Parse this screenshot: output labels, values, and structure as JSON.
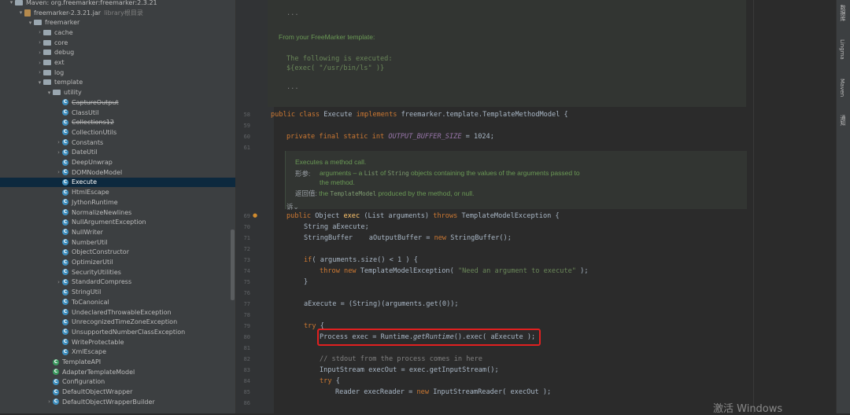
{
  "tree": {
    "items": [
      {
        "label": "Maven: org.freemarker:freemarker:2.3.21",
        "indent": 0,
        "arrow": "▾",
        "icon": "folder"
      },
      {
        "label": "freemarker-2.3.21.jar",
        "extra": "library根目录",
        "indent": 1,
        "arrow": "▾",
        "icon": "jar"
      },
      {
        "label": "freemarker",
        "indent": 2,
        "arrow": "▾",
        "icon": "folder"
      },
      {
        "label": "cache",
        "indent": 3,
        "arrow": "›",
        "icon": "folder"
      },
      {
        "label": "core",
        "indent": 3,
        "arrow": "›",
        "icon": "folder"
      },
      {
        "label": "debug",
        "indent": 3,
        "arrow": "›",
        "icon": "folder"
      },
      {
        "label": "ext",
        "indent": 3,
        "arrow": "›",
        "icon": "folder"
      },
      {
        "label": "log",
        "indent": 3,
        "arrow": "›",
        "icon": "folder"
      },
      {
        "label": "template",
        "indent": 3,
        "arrow": "▾",
        "icon": "folder"
      },
      {
        "label": "utility",
        "indent": 4,
        "arrow": "▾",
        "icon": "folder"
      },
      {
        "label": "CaptureOutput",
        "indent": 5,
        "icon": "class",
        "strike": true
      },
      {
        "label": "ClassUtil",
        "indent": 5,
        "icon": "class"
      },
      {
        "label": "Collections12",
        "indent": 5,
        "icon": "class",
        "strike": true
      },
      {
        "label": "CollectionUtils",
        "indent": 5,
        "icon": "class"
      },
      {
        "label": "Constants",
        "indent": 5,
        "arrow": "›",
        "icon": "class"
      },
      {
        "label": "DateUtil",
        "indent": 5,
        "arrow": "›",
        "icon": "class"
      },
      {
        "label": "DeepUnwrap",
        "indent": 5,
        "icon": "class"
      },
      {
        "label": "DOMNodeModel",
        "indent": 5,
        "arrow": "›",
        "icon": "class"
      },
      {
        "label": "Execute",
        "indent": 5,
        "icon": "class",
        "selected": true
      },
      {
        "label": "HtmlEscape",
        "indent": 5,
        "icon": "class"
      },
      {
        "label": "JythonRuntime",
        "indent": 5,
        "icon": "class"
      },
      {
        "label": "NormalizeNewlines",
        "indent": 5,
        "icon": "class"
      },
      {
        "label": "NullArgumentException",
        "indent": 5,
        "icon": "class"
      },
      {
        "label": "NullWriter",
        "indent": 5,
        "icon": "class"
      },
      {
        "label": "NumberUtil",
        "indent": 5,
        "icon": "class"
      },
      {
        "label": "ObjectConstructor",
        "indent": 5,
        "icon": "class"
      },
      {
        "label": "OptimizerUtil",
        "indent": 5,
        "icon": "class"
      },
      {
        "label": "SecurityUtilities",
        "indent": 5,
        "icon": "class"
      },
      {
        "label": "StandardCompress",
        "indent": 5,
        "arrow": "›",
        "icon": "class"
      },
      {
        "label": "StringUtil",
        "indent": 5,
        "icon": "class"
      },
      {
        "label": "ToCanonical",
        "indent": 5,
        "icon": "class"
      },
      {
        "label": "UndeclaredThrowableException",
        "indent": 5,
        "icon": "class"
      },
      {
        "label": "UnrecognizedTimeZoneException",
        "indent": 5,
        "icon": "class"
      },
      {
        "label": "UnsupportedNumberClassException",
        "indent": 5,
        "icon": "class"
      },
      {
        "label": "WriteProtectable",
        "indent": 5,
        "icon": "class"
      },
      {
        "label": "XmlEscape",
        "indent": 5,
        "icon": "class"
      },
      {
        "label": "TemplateAPI",
        "indent": 4,
        "icon": "class",
        "green": true
      },
      {
        "label": "AdapterTemplateModel",
        "indent": 4,
        "icon": "class",
        "green": true
      },
      {
        "label": "Configuration",
        "indent": 4,
        "icon": "class"
      },
      {
        "label": "DefaultObjectWrapper",
        "indent": 4,
        "icon": "class"
      },
      {
        "label": "DefaultObjectWrapperBuilder",
        "indent": 4,
        "arrow": "›",
        "icon": "class"
      }
    ]
  },
  "doc_top": {
    "ellipsis1": "...",
    "from_text": "From your FreeMarker template:",
    "exec_line1": "The following is executed:",
    "exec_line2": "${exec( \"/usr/bin/ls\" )}",
    "ellipsis2": "..."
  },
  "doc_method": {
    "summary": "Executes a method call.",
    "param_label": "形参:",
    "param_text_a": "arguments – a ",
    "param_code_list": "List",
    "param_text_b": " of ",
    "param_code_string": "String",
    "param_text_c": " objects containing the values of the arguments passed to",
    "param_text_d": "the method.",
    "return_label": "返回值:",
    "return_text_a": "the ",
    "return_code": "TemplateModel",
    "return_text_b": " produced by the method, or null.",
    "collapse": "诉⌄"
  },
  "line_numbers": {
    "l58": "58",
    "l59": "59",
    "l60": "60",
    "l61": "61",
    "l69": "69",
    "l70": "70",
    "l71": "71",
    "l72": "72",
    "l73": "73",
    "l74": "74",
    "l75": "75",
    "l76": "76",
    "l77": "77",
    "l78": "78",
    "l79": "79",
    "l80": "80",
    "l81": "81",
    "l82": "82",
    "l83": "83",
    "l84": "84",
    "l85": "85",
    "l86": "86"
  },
  "code": {
    "c58a": "public class ",
    "c58b": "Execute ",
    "c58c": "implements ",
    "c58d": "freemarker.template.TemplateMethodModel {",
    "c60a": "private final static int ",
    "c60b": "OUTPUT_BUFFER_SIZE",
    "c60c": " = 1024;",
    "c69a": "public ",
    "c69b": "Object ",
    "c69c": "exec",
    "c69d": " (List arguments) ",
    "c69e": "throws ",
    "c69f": "TemplateModelException {",
    "c70": "String aExecute;",
    "c71a": "StringBuffer    aOutputBuffer = ",
    "c71b": "new ",
    "c71c": "StringBuffer();",
    "c73a": "if",
    "c73b": "( arguments.size() < 1 ) {",
    "c74a": "throw new ",
    "c74b": "TemplateModelException( ",
    "c74c": "\"Need an argument to execute\"",
    "c74d": " );",
    "c75": "}",
    "c77": "aExecute = (String)(arguments.get(0));",
    "c79a": "try",
    "c79b": " {",
    "c80a": "Process exec = Runtime.",
    "c80b": "getRuntime",
    "c80c": "().exec( aExecute );",
    "c82": "// stdout from the process comes in here",
    "c83": "InputStream execOut = exec.getInputStream();",
    "c84a": "try",
    "c84b": " {",
    "c85a": "Reader execReader = ",
    "c85b": "new ",
    "c85c": "InputStreamReader( execOut );"
  },
  "side": {
    "t1": "数据库",
    "t2": "Lingma",
    "t3": "Maven",
    "t4": "通知"
  },
  "watermark": "激活 Windows"
}
